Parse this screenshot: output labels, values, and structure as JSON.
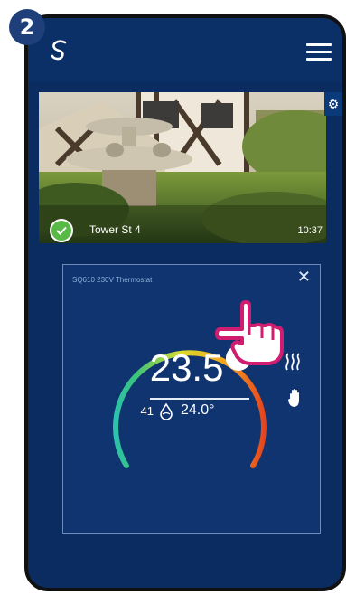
{
  "step": {
    "number": "2"
  },
  "header": {
    "logo_icon": "app-logo-icon",
    "menu_icon": "hamburger-menu-icon"
  },
  "location": {
    "name": "Tower St 4",
    "time": "10:37",
    "status_icon": "check-icon"
  },
  "thermostat": {
    "device_name": "SQ610 230V Thermostat",
    "current_temp": "23.5°",
    "humidity": "41",
    "set_temp": "24.0°",
    "mode_icons": [
      "heating-icon",
      "manual-mode-hand-icon"
    ]
  },
  "colors": {
    "phone_bg": "#0a2c61",
    "panel_bg": "#0f3470",
    "badge": "#1e3f7a",
    "accent_pink": "#d11d6f"
  }
}
